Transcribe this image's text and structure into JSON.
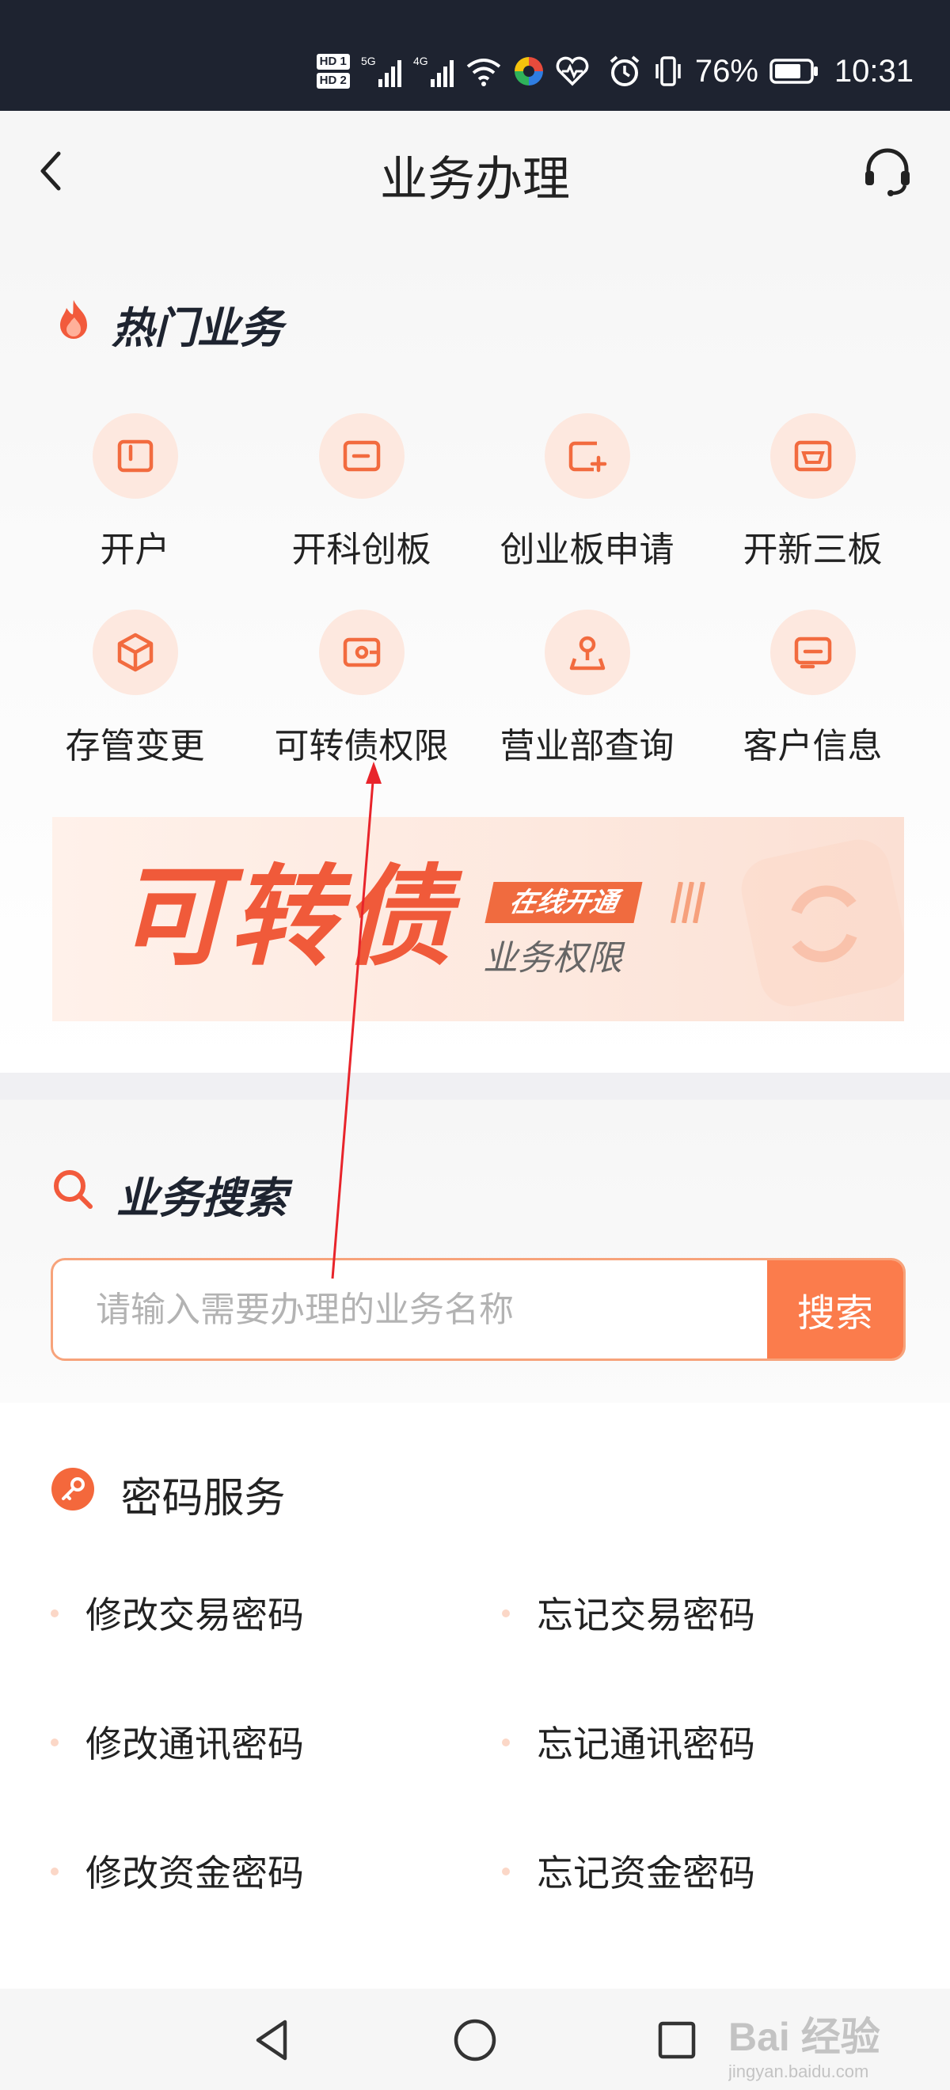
{
  "status_bar": {
    "hd1": "HD 1",
    "hd2": "HD 2",
    "signal1": "5G",
    "signal2": "4G",
    "battery": "76%",
    "time": "10:31"
  },
  "header": {
    "title": "业务办理",
    "back_icon": "chevron-left-icon",
    "service_icon": "headset-icon"
  },
  "hot_services": {
    "title": "热门业务",
    "items": [
      {
        "label": "开户",
        "icon": "open-account-icon"
      },
      {
        "label": "开科创板",
        "icon": "star-market-icon"
      },
      {
        "label": "创业板申请",
        "icon": "gem-apply-icon"
      },
      {
        "label": "开新三板",
        "icon": "neeq-icon"
      },
      {
        "label": "存管变更",
        "icon": "box-icon"
      },
      {
        "label": "可转债权限",
        "icon": "wallet-icon"
      },
      {
        "label": "营业部查询",
        "icon": "location-pin-icon"
      },
      {
        "label": "客户信息",
        "icon": "customer-info-icon"
      }
    ]
  },
  "banner": {
    "title": "可转债",
    "tag": "在线开通",
    "subtitle": "业务权限"
  },
  "search": {
    "title": "业务搜索",
    "placeholder": "请输入需要办理的业务名称",
    "button_label": "搜索"
  },
  "password_services": {
    "title": "密码服务",
    "items": [
      "修改交易密码",
      "忘记交易密码",
      "修改通讯密码",
      "忘记通讯密码",
      "修改资金密码",
      "忘记资金密码"
    ]
  },
  "colors": {
    "accent": "#fb7c4c",
    "icon_bg": "#fde8df",
    "annotation": "#e8242b"
  },
  "watermark": {
    "text": "Bai 经验",
    "url": "jingyan.baidu.com"
  }
}
